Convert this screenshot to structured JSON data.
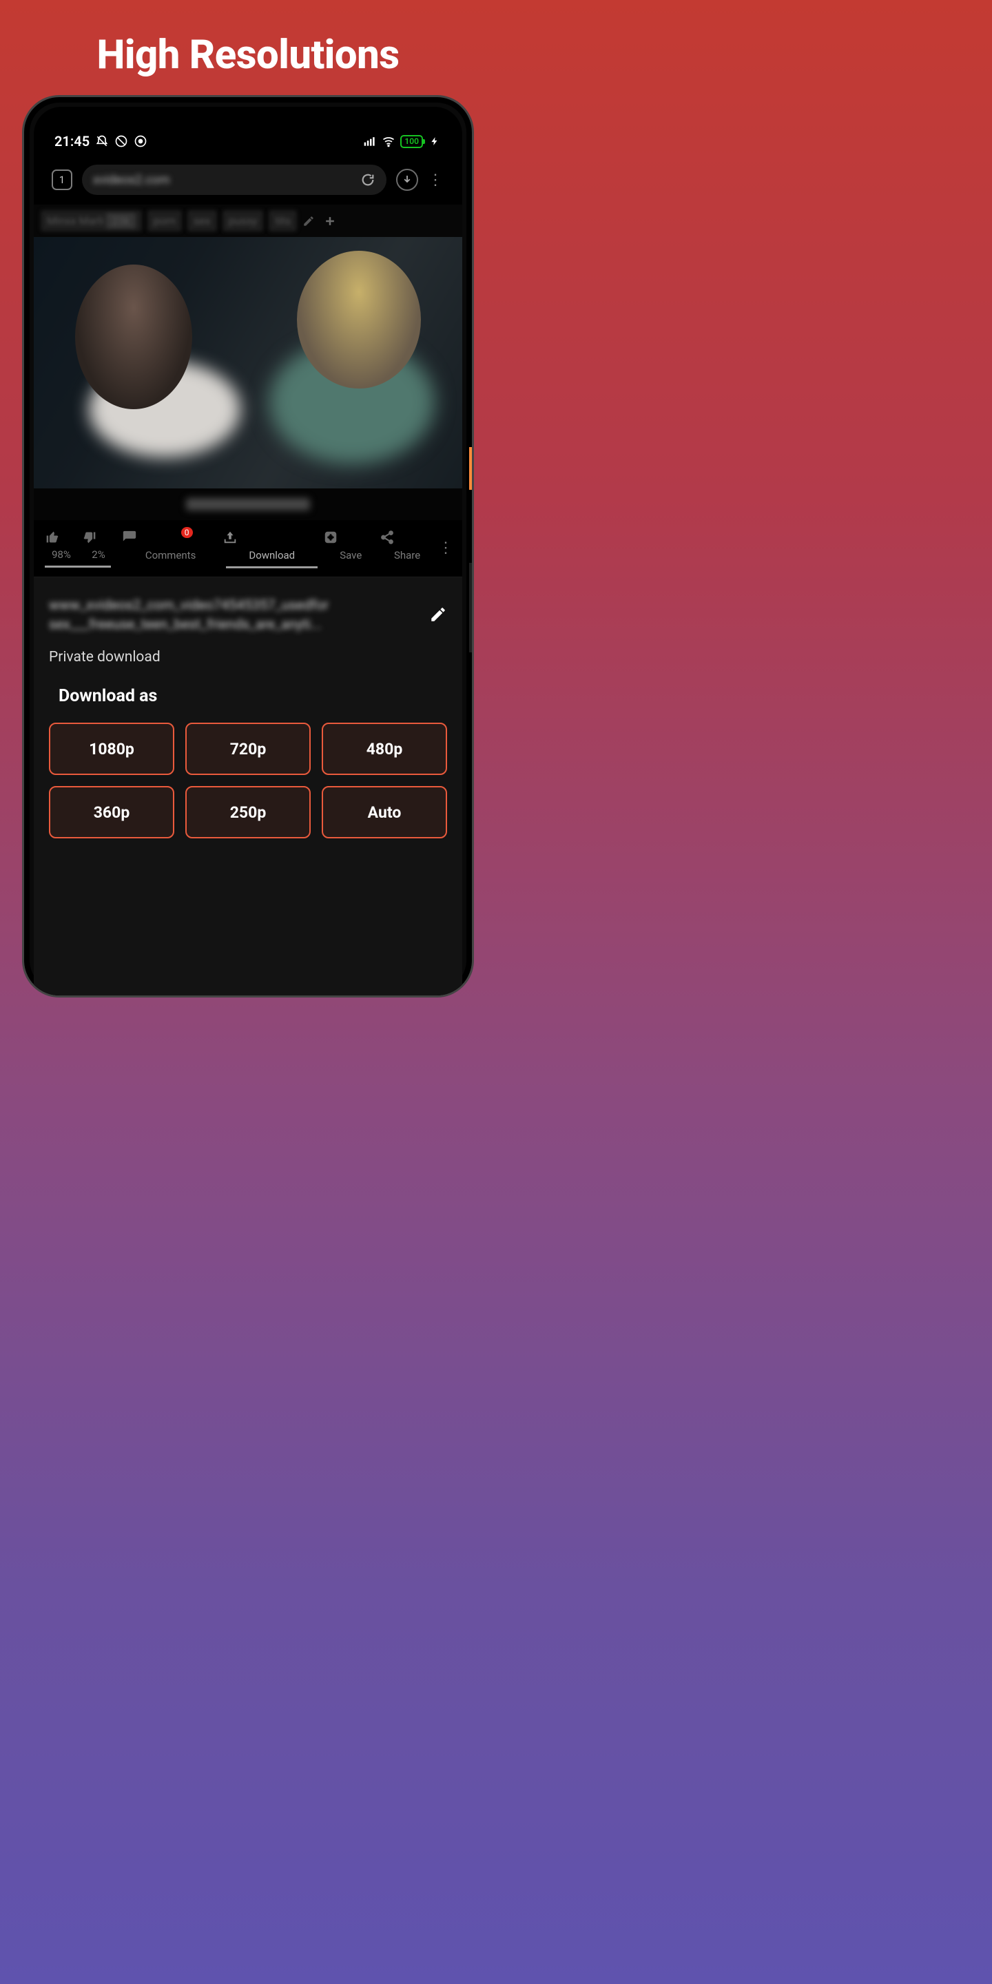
{
  "headline": "High Resolutions",
  "status": {
    "time": "21:45",
    "battery": "100"
  },
  "browser": {
    "tab_count": "1",
    "url_display": "xvideos2.com"
  },
  "tags": [
    "Minxx Marli",
    "porn",
    "sex",
    "pussy",
    "tits"
  ],
  "tag_badge": "23k",
  "actions": {
    "like_pct": "98%",
    "dislike_pct": "2%",
    "comments": "Comments",
    "comments_badge": "0",
    "download": "Download",
    "save": "Save",
    "share": "Share"
  },
  "download_panel": {
    "url_blur_text": "www_xvideos2_com_video74545357_usedfor sex___freeuse_teen_best_friends_are_anyti...",
    "private_label": "Private download",
    "download_as": "Download as",
    "resolutions": [
      "1080p",
      "720p",
      "480p",
      "360p",
      "250p",
      "Auto"
    ]
  }
}
